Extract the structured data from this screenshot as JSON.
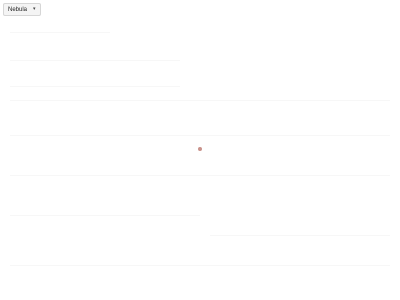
{
  "selector": {
    "value": "Nebula",
    "chevron_icon": "chevron-down-icon"
  },
  "colors": {
    "background": "#ffffff",
    "marker": "#c9928b"
  }
}
